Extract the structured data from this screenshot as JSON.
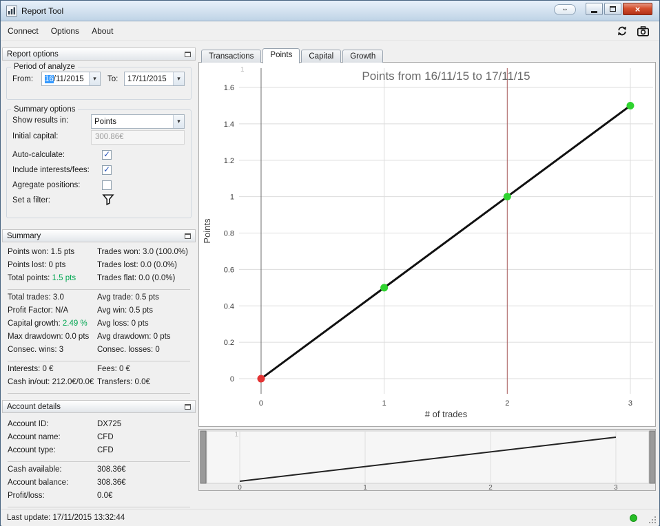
{
  "colors": {
    "green_text": "#00a651",
    "selection_blue": "#3399ff",
    "status_dot_green": "#27bd27"
  },
  "icons": {
    "detach": "⇔",
    "close": "×",
    "combo_arrow": "▾",
    "check": "✓",
    "refresh": "refresh-icon",
    "camera": "camera-icon",
    "filter": "funnel-icon"
  },
  "titlebar": {
    "title": "Report Tool"
  },
  "menubar": {
    "items": [
      "Connect",
      "Options",
      "About"
    ]
  },
  "report_options": {
    "header": "Report options",
    "period": {
      "legend": "Period of analyze",
      "from_label": "From:",
      "from_selected": "16",
      "from_rest": "/11/2015",
      "to_label": "To:",
      "to_value": "17/11/2015"
    },
    "options": {
      "legend": "Summary options",
      "show_results_label": "Show results in:",
      "show_results_value": "Points",
      "initial_capital_label": "Initial capital:",
      "initial_capital_value": "300.86€",
      "auto_calculate_label": "Auto-calculate:",
      "auto_calculate_checked": true,
      "include_label": "Include interests/fees:",
      "include_checked": true,
      "agregate_label": "Agregate positions:",
      "agregate_checked": false,
      "filter_label": "Set a filter:"
    }
  },
  "summary": {
    "header": "Summary",
    "groups": [
      {
        "rows": [
          {
            "left": {
              "label": "Points won:",
              "value": "1.5 pts"
            },
            "right": {
              "label": "Trades won:",
              "value": "3.0 (100.0%)"
            }
          },
          {
            "left": {
              "label": "Points lost:",
              "value": "0 pts"
            },
            "right": {
              "label": "Trades lost:",
              "value": "0.0 (0.0%)"
            }
          },
          {
            "left": {
              "label": "Total points:",
              "value": "1.5 pts",
              "green": true
            },
            "right": {
              "label": "Trades flat:",
              "value": "0.0 (0.0%)"
            }
          }
        ]
      },
      {
        "rows": [
          {
            "left": {
              "label": "Total trades:",
              "value": "3.0"
            },
            "right": {
              "label": "Avg trade:",
              "value": "0.5 pts"
            }
          },
          {
            "left": {
              "label": "Profit Factor:",
              "value": "N/A"
            },
            "right": {
              "label": "Avg win:",
              "value": "0.5 pts"
            }
          },
          {
            "left": {
              "label": "Capital growth:",
              "value": "2.49 %",
              "green": true
            },
            "right": {
              "label": "Avg loss:",
              "value": "0 pts"
            }
          },
          {
            "left": {
              "label": "Max drawdown:",
              "value": "0.0 pts"
            },
            "right": {
              "label": "Avg drawdown:",
              "value": "0 pts"
            }
          },
          {
            "left": {
              "label": "Consec. wins:",
              "value": "3"
            },
            "right": {
              "label": "Consec. losses:",
              "value": "0"
            }
          }
        ]
      },
      {
        "rows": [
          {
            "left": {
              "label": "Interests:",
              "value": "0 €"
            },
            "right": {
              "label": "Fees:",
              "value": "0 €"
            }
          },
          {
            "left": {
              "label": "Cash in/out:",
              "value": "212.0€/0.0€"
            },
            "right": {
              "label": "Transfers:",
              "value": "0.0€"
            }
          }
        ]
      }
    ]
  },
  "account": {
    "header": "Account details",
    "groups": [
      [
        {
          "label": "Account ID:",
          "value": "DX725"
        },
        {
          "label": "Account name:",
          "value": "CFD"
        },
        {
          "label": "Account type:",
          "value": "CFD"
        }
      ],
      [
        {
          "label": "Cash available:",
          "value": "308.36€"
        },
        {
          "label": "Account balance:",
          "value": "308.36€"
        },
        {
          "label": "Profit/loss:",
          "value": "0.0€"
        }
      ]
    ]
  },
  "statusbar": {
    "last_update": "Last update: 17/11/2015 13:32:44"
  },
  "tabs": [
    {
      "label": "Transactions",
      "active": false
    },
    {
      "label": "Points",
      "active": true
    },
    {
      "label": "Capital",
      "active": false
    },
    {
      "label": "Growth",
      "active": false
    }
  ],
  "chart_data": {
    "type": "line",
    "title": "Points from 16/11/15 to 17/11/15",
    "xlabel": "# of trades",
    "ylabel": "Points",
    "x": [
      0,
      1,
      2,
      3
    ],
    "y": [
      0,
      0.5,
      1,
      1.5
    ],
    "line_color": "#111111",
    "point_colors": [
      "#e43434",
      "#2fd32f",
      "#2fd32f",
      "#2fd32f"
    ],
    "xticks": [
      0,
      1,
      2,
      3
    ],
    "yticks": [
      0,
      0.2,
      0.4,
      0.6,
      0.8,
      1,
      1.2,
      1.4,
      1.6
    ],
    "xlim": [
      -0.179,
      3.185
    ],
    "ylim": [
      -0.083,
      1.706
    ],
    "grid": true,
    "legend": "none",
    "axis_x": 0,
    "marker_x": 2,
    "marker_color": "#a85b5b",
    "corner_label": "1",
    "minichart": {
      "x": [
        0,
        3
      ],
      "y": [
        0,
        1.5
      ],
      "xticks": [
        0,
        1,
        2,
        3
      ],
      "xlim": [
        -0.264,
        3.264
      ],
      "ylim": [
        -0.07,
        1.711
      ],
      "corner_label": "1"
    }
  }
}
